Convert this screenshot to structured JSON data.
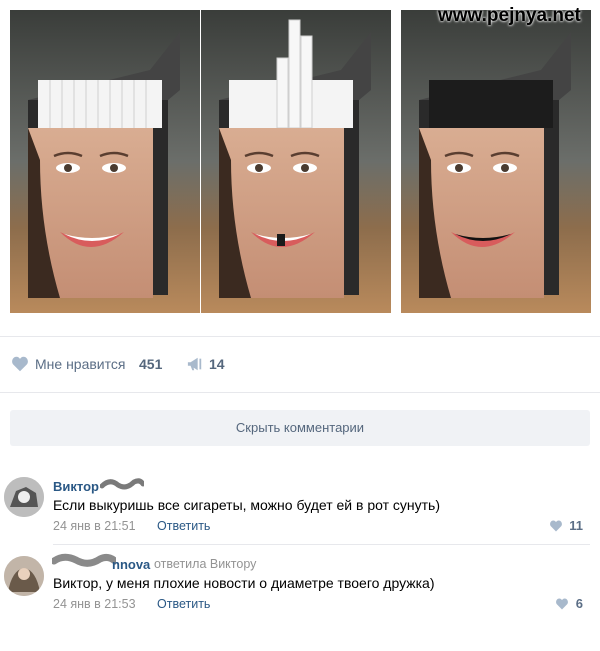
{
  "watermark": "www.pejnya.net",
  "post": {
    "panels": [
      "smile-full",
      "smile-missing-tooth",
      "smile-no-teeth"
    ],
    "like_label": "Мне нравится",
    "like_count": "451",
    "share_count": "14"
  },
  "comments_toggle": "Скрыть комментарии",
  "comments": [
    {
      "author": "Виктор",
      "author_suffix_hidden": true,
      "text": "Если выкуришь все сигареты, можно будет ей в рот сунуть)",
      "date": "24 янв в 21:51",
      "reply_label": "Ответить",
      "likes": "11"
    },
    {
      "author": "nnova",
      "replied_to": "ответила Виктору",
      "text": "Виктор, у меня плохие новости о диаметре твоего дружка)",
      "date": "24 янв в 21:53",
      "reply_label": "Ответить",
      "likes": "6"
    }
  ],
  "colors": {
    "link": "#2a5885",
    "muted": "#939393",
    "icon": "#a8b9cc",
    "button_bg": "#f0f2f5"
  },
  "icons": [
    "heart-icon",
    "megaphone-icon"
  ]
}
